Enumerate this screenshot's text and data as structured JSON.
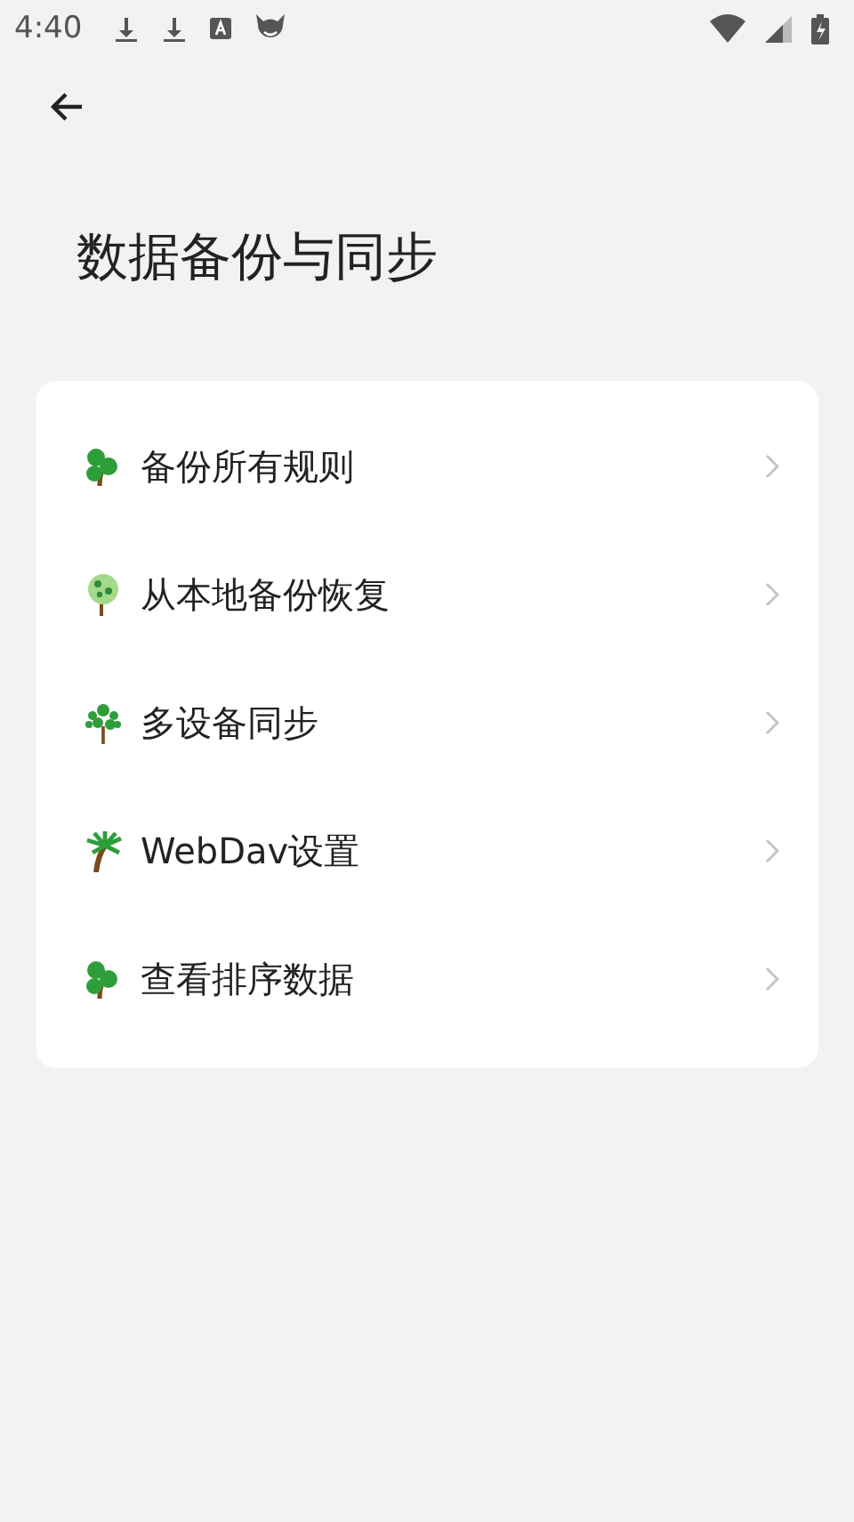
{
  "status_bar": {
    "time": "4:40"
  },
  "title": "数据备份与同步",
  "items": [
    {
      "label": "备份所有规则",
      "kind": "sprout"
    },
    {
      "label": "从本地备份恢复",
      "kind": "bush"
    },
    {
      "label": "多设备同步",
      "kind": "dots"
    },
    {
      "label": "WebDav设置",
      "kind": "palm"
    },
    {
      "label": "查看排序数据",
      "kind": "sprout"
    }
  ]
}
